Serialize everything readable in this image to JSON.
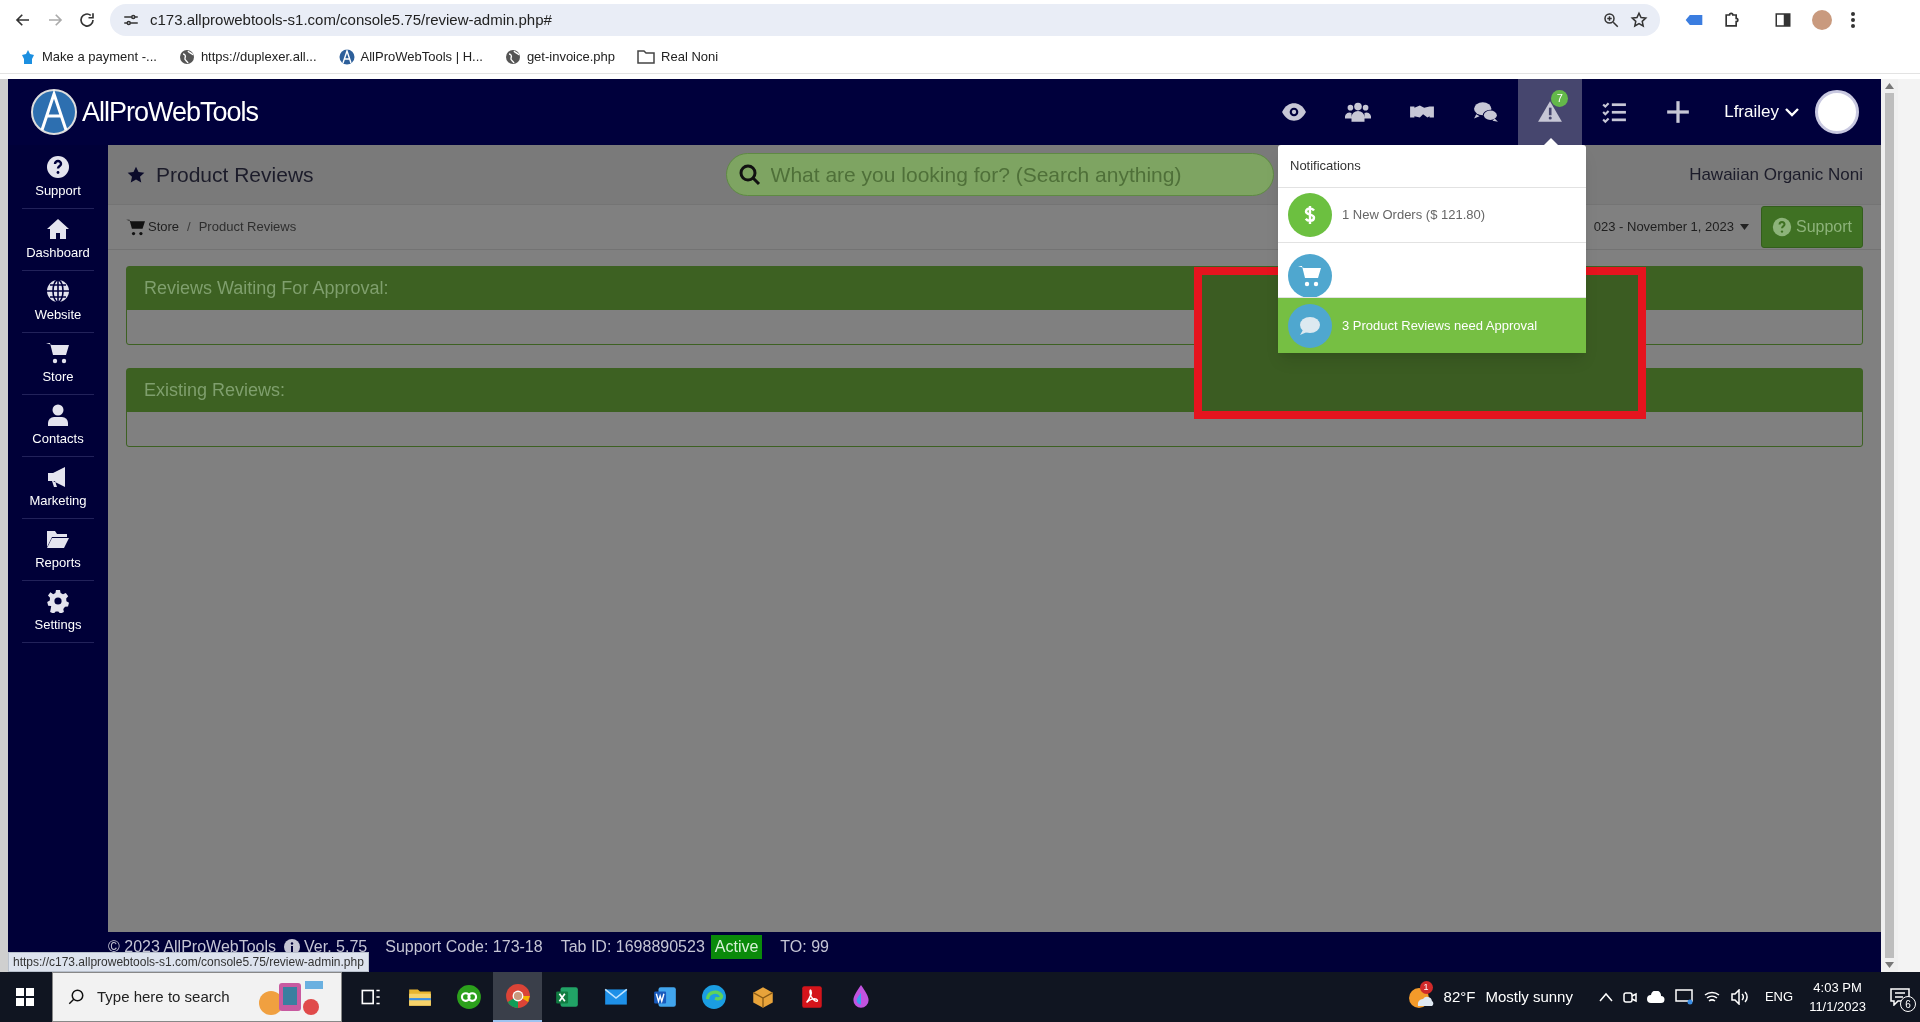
{
  "browser": {
    "url": "c173.allprowebtools-s1.com/console5.75/review-admin.php#",
    "bookmarks": [
      {
        "kind": "bank",
        "label": "Make a payment -..."
      },
      {
        "kind": "globe",
        "label": "https://duplexer.all..."
      },
      {
        "kind": "logo",
        "label": "AllProWebTools | H..."
      },
      {
        "kind": "globe",
        "label": "get-invoice.php"
      },
      {
        "kind": "folder",
        "label": "Real Noni"
      }
    ],
    "status_url": "https://c173.allprowebtools-s1.com/console5.75/review-admin.php"
  },
  "app": {
    "brand": "AllProWebTools",
    "header_icons": [
      {
        "kind": "eye",
        "selected": false
      },
      {
        "kind": "users",
        "selected": false
      },
      {
        "kind": "handshake",
        "selected": false
      },
      {
        "kind": "chat",
        "selected": false
      },
      {
        "kind": "alert",
        "selected": true,
        "badge": "7"
      },
      {
        "kind": "checklist",
        "selected": false
      },
      {
        "kind": "plus",
        "selected": false
      }
    ],
    "user": "Lfrailey",
    "sidebar": [
      {
        "kind": "question",
        "label": "Support"
      },
      {
        "kind": "home",
        "label": "Dashboard"
      },
      {
        "kind": "globe",
        "label": "Website"
      },
      {
        "kind": "cart",
        "label": "Store"
      },
      {
        "kind": "user",
        "label": "Contacts"
      },
      {
        "kind": "megaphone",
        "label": "Marketing"
      },
      {
        "kind": "folder",
        "label": "Reports"
      },
      {
        "kind": "gear",
        "label": "Settings"
      }
    ],
    "page_title": "Product Reviews",
    "search": {
      "placeholder": "What are you looking for? (Search anything)"
    },
    "store_name": "Hawaiian Organic Noni",
    "breadcrumb": [
      "Store",
      "Product Reviews"
    ],
    "breadcrumb_separator": "/",
    "date_range": "023 - November 1, 2023",
    "support_button": "Support",
    "panels": [
      {
        "title": "Reviews Waiting For Approval:"
      },
      {
        "title": "Existing Reviews:"
      }
    ],
    "notifications": {
      "title": "Notifications",
      "items": [
        {
          "kind": "dollar",
          "text": "1 New Orders ($ 121.80)",
          "selected": false
        },
        {
          "kind": "cart",
          "selected": false
        },
        {
          "kind": "chat",
          "text": "3 Product Reviews need Approval",
          "selected": true
        }
      ]
    },
    "footer": {
      "copyright": "© 2023 AllProWebTools",
      "version": "Ver. 5.75",
      "support_code": "Support Code: 173-18",
      "tab_id": "Tab ID: 1698890523",
      "status": "Active",
      "timeout": "TO: 99"
    }
  },
  "taskbar": {
    "search_placeholder": "Type here to search",
    "apps": [
      {
        "kind": "taskview",
        "selected": false
      },
      {
        "kind": "files",
        "selected": false
      },
      {
        "kind": "qb",
        "selected": false
      },
      {
        "kind": "chrome",
        "selected": true
      },
      {
        "kind": "excel",
        "selected": false
      },
      {
        "kind": "mail",
        "selected": false
      },
      {
        "kind": "word",
        "selected": false
      },
      {
        "kind": "edge",
        "selected": false
      },
      {
        "kind": "package",
        "selected": false
      },
      {
        "kind": "pdf",
        "selected": false
      },
      {
        "kind": "drop",
        "selected": false
      }
    ],
    "weather": {
      "badge": "1",
      "temperature": "82°F",
      "condition": "Mostly sunny"
    },
    "language": "ENG",
    "time": "4:03 PM",
    "date": "11/1/2023",
    "notification_count": "6"
  }
}
